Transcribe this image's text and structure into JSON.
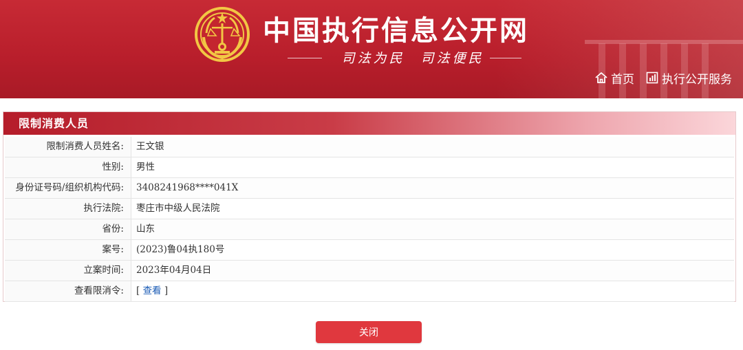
{
  "header": {
    "title": "中国执行信息公开网",
    "slogan": "司法为民　司法便民",
    "nav": [
      {
        "label": "首页",
        "icon": "home-icon"
      },
      {
        "label": "执行公开服务",
        "icon": "service-icon"
      }
    ]
  },
  "panel": {
    "title": "限制消费人员",
    "rows": [
      {
        "label": "限制消费人员姓名:",
        "value": "王文银"
      },
      {
        "label": "性别:",
        "value": "男性"
      },
      {
        "label": "身份证号码/组织机构代码:",
        "value": "3408241968****041X"
      },
      {
        "label": "执行法院:",
        "value": "枣庄市中级人民法院"
      },
      {
        "label": "省份:",
        "value": "山东"
      },
      {
        "label": "案号:",
        "value": "(2023)鲁04执180号"
      },
      {
        "label": "立案时间:",
        "value": "2023年04月04日"
      },
      {
        "label": "查看限消令:",
        "link_open": "[ ",
        "link_text": "查看",
        "link_close": " ]"
      }
    ]
  },
  "close_button": {
    "label": "关闭"
  },
  "colors": {
    "brand_red": "#b81e2b",
    "button_red": "#e0383e",
    "link_blue": "#1a5bb5"
  }
}
